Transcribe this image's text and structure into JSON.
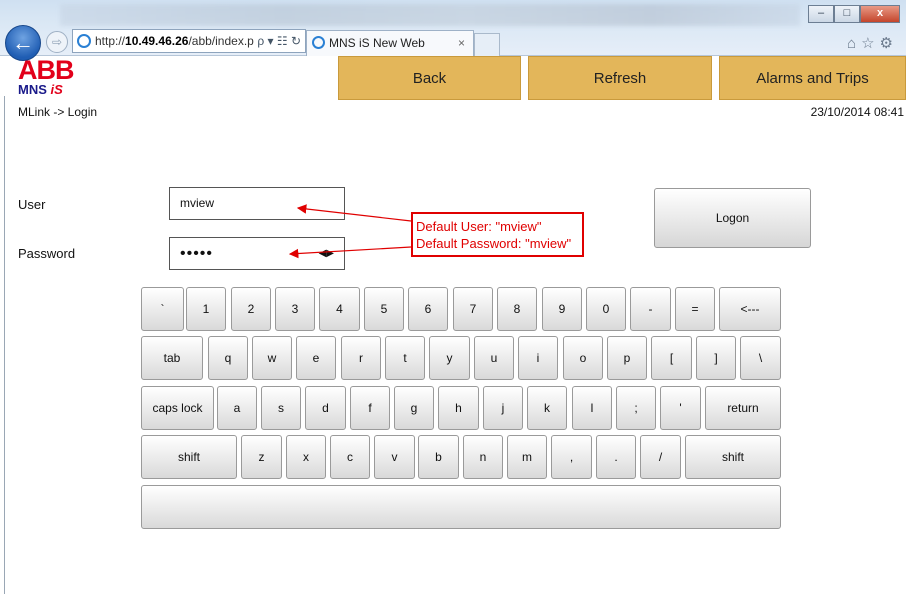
{
  "browser": {
    "url_prefix": "http://",
    "url_host": "10.49.46.26",
    "url_path": "/abb/index.p",
    "address_icons": "ρ ▾ ☷ ↻",
    "tab_title": "MNS iS New Web",
    "tab_close": "×",
    "back_glyph": "←",
    "forward_glyph": "⇨",
    "minimize_glyph": "–",
    "maximize_glyph": "□",
    "close_glyph": "x",
    "toolbar_icons": "⌂☆⚙"
  },
  "logo": {
    "brand": "ABB",
    "product_main": "MNS",
    "product_suffix": "iS"
  },
  "toolbar": {
    "back": "Back",
    "refresh": "Refresh",
    "alarms": "Alarms and Trips"
  },
  "breadcrumb": "MLink -> Login",
  "datetime": "23/10/2014 08:41",
  "login": {
    "user_label": "User",
    "user_value": "mview",
    "password_label": "Password",
    "password_value": "•••••",
    "reveal_icon": "◀▶",
    "logon": "Logon"
  },
  "annotation": {
    "line1": "Default User: \"mview\"",
    "line2": "Default Password: \"mview\""
  },
  "keyboard": {
    "rows": [
      [
        "`",
        "1",
        "2",
        "3",
        "4",
        "5",
        "6",
        "7",
        "8",
        "9",
        "0",
        "-",
        "=",
        "<---"
      ],
      [
        "tab",
        "q",
        "w",
        "e",
        "r",
        "t",
        "y",
        "u",
        "i",
        "o",
        "p",
        "[",
        "]",
        "\\"
      ],
      [
        "caps lock",
        "a",
        "s",
        "d",
        "f",
        "g",
        "h",
        "j",
        "k",
        "l",
        ";",
        "'",
        "return"
      ],
      [
        "shift",
        "z",
        "x",
        "c",
        "v",
        "b",
        "n",
        "m",
        ",",
        ".",
        "/",
        "shift"
      ],
      [
        ""
      ]
    ]
  },
  "colors": {
    "toolbar_button": "#e3b65a",
    "brand_red": "#e2001a",
    "annotation_red": "#e00000"
  }
}
